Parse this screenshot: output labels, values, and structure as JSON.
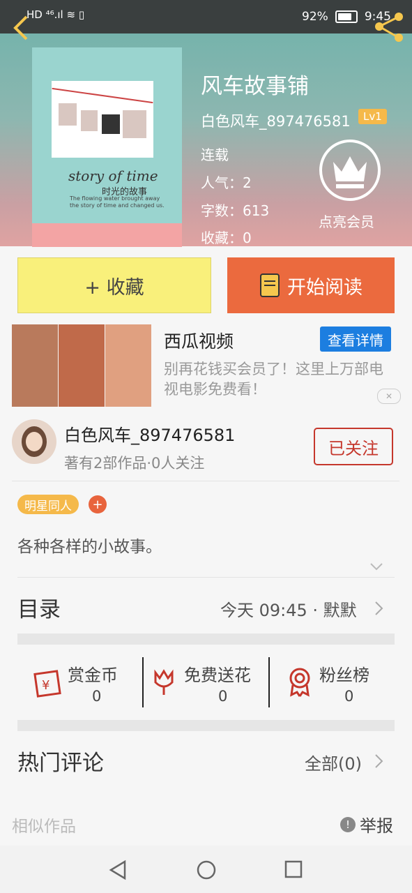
{
  "status_bar": {
    "left": "HD ⁴⁶.ıl ≋ ▯",
    "battery": "92%",
    "time": "9:45"
  },
  "book": {
    "title": "风车故事铺",
    "author": "白色风车_897476581",
    "level": "Lv1",
    "status": "连载",
    "popularity": "人气：2",
    "word_count": "字数：613",
    "favorites": "收藏：0",
    "vip_label": "点亮会员",
    "cover_title": "story of time",
    "cover_subtitle_cn": "时光的故事",
    "cover_subtitle_en": "The flowing water brought away the story of time and changed us."
  },
  "actions": {
    "collect": "+ 收藏",
    "read": "开始阅读"
  },
  "ad": {
    "title": "西瓜视频",
    "button": "查看详情",
    "desc": "别再花钱买会员了！这里上万部电视电影免费看！",
    "close": "✕"
  },
  "author_card": {
    "name": "白色风车_897476581",
    "stats": "著有2部作品·0人关注",
    "follow": "已关注"
  },
  "tags": {
    "tag1": "明星同人",
    "add": "+"
  },
  "intro": "各种各样的小故事。",
  "catalog": {
    "title": "目录",
    "latest": "今天 09:45 · 默默"
  },
  "rewards": [
    {
      "label": "赏金币",
      "value": "0"
    },
    {
      "label": "免费送花",
      "value": "0"
    },
    {
      "label": "粉丝榜",
      "value": "0"
    }
  ],
  "comments": {
    "title": "热门评论",
    "all": "全部(0)"
  },
  "footer": {
    "similar": "相似作品",
    "report": "举报"
  }
}
